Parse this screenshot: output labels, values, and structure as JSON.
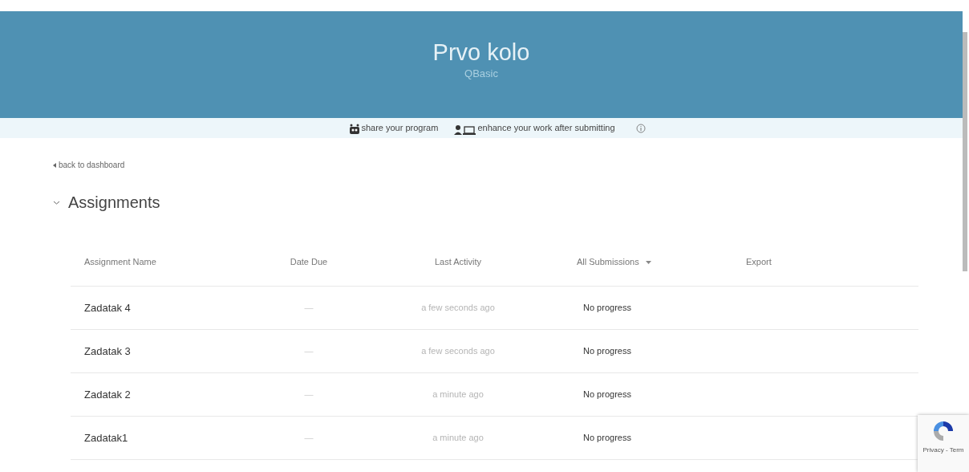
{
  "header": {
    "title": "Prvo kolo",
    "subtitle": "QBasic"
  },
  "info_bar": {
    "items": [
      {
        "kind": "share",
        "label": "share your program"
      },
      {
        "kind": "enhance",
        "label": "enhance your work after submitting"
      }
    ]
  },
  "back_link": "back to dashboard",
  "section": {
    "title": "Assignments",
    "expanded": true
  },
  "table": {
    "columns": [
      "Assignment Name",
      "Date Due",
      "Last Activity",
      "All Submissions",
      "Export"
    ],
    "rows": [
      {
        "name": "Zadatak 4",
        "date_due": "—",
        "last_activity": "a few seconds ago",
        "status": "No progress"
      },
      {
        "name": "Zadatak 3",
        "date_due": "—",
        "last_activity": "a few seconds ago",
        "status": "No progress"
      },
      {
        "name": "Zadatak 2",
        "date_due": "—",
        "last_activity": "a minute ago",
        "status": "No progress"
      },
      {
        "name": "Zadatak1",
        "date_due": "—",
        "last_activity": "a minute ago",
        "status": "No progress"
      }
    ]
  },
  "recaptcha": {
    "label": "Privacy - Term"
  }
}
